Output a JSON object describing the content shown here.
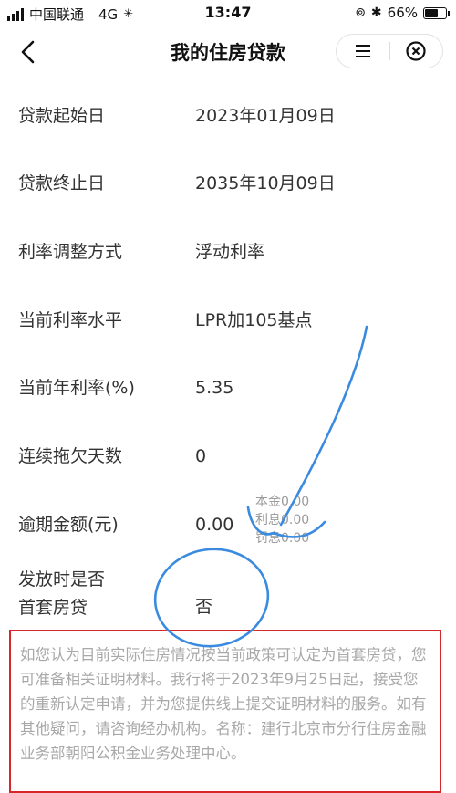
{
  "status_bar": {
    "carrier": "中国联通",
    "network": "4G",
    "time": "13:47",
    "battery": "66%",
    "battery_level": 0.66
  },
  "nav": {
    "title": "我的住房贷款",
    "back_icon": "chevron-left-icon",
    "menu_icon": "menu-icon",
    "close_icon": "close-circle-icon"
  },
  "loan": {
    "rows": [
      {
        "label": "贷款起始日",
        "value": "2023年01月09日"
      },
      {
        "label": "贷款终止日",
        "value": "2035年10月09日"
      },
      {
        "label": "利率调整方式",
        "value": "浮动利率"
      },
      {
        "label": "当前利率水平",
        "value": "LPR加105基点"
      },
      {
        "label": "当前年利率(%)",
        "value": "5.35"
      },
      {
        "label": "连续拖欠天数",
        "value": "0"
      },
      {
        "label": "逾期金额(元)",
        "value": "0.00"
      }
    ],
    "overdue_detail": {
      "principal": "本金0.00",
      "interest": "利息0.00",
      "penalty": "罚息0.00"
    },
    "first_home": {
      "label_line1": "发放时是否",
      "label_line2": "首套房贷",
      "value": "否"
    }
  },
  "notice": {
    "text": "如您认为目前实际住房情况按当前政策可认定为首套房贷，您可准备相关证明材料。我行将于2023年9月25日起，接受您的重新认定申请，并为您提供线上提交证明材料的服务。如有其他疑问，请咨询经办机构。名称：建行北京市分行住房金融业务部朝阳公积金业务处理中心。"
  },
  "colors": {
    "annotation_blue": "#3a8be0",
    "notice_border": "#d8262b",
    "notice_text": "#a8a8a8"
  }
}
